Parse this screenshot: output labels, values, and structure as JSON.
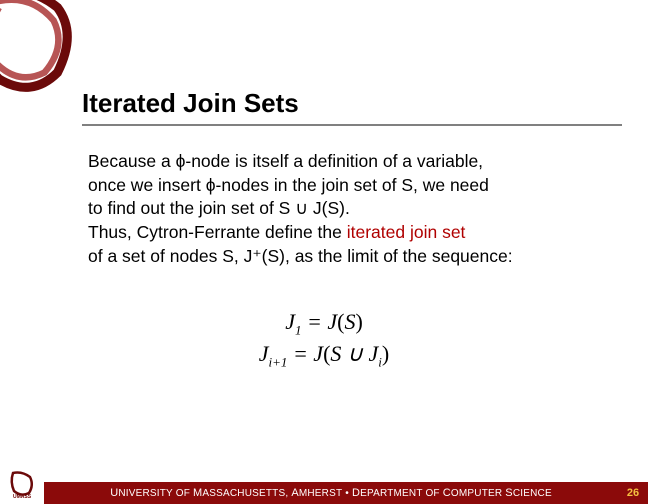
{
  "title": "Iterated Join Sets",
  "body": {
    "l1a": "Because a ",
    "l1b": "-node is itself a definition of a variable,",
    "l2a": "once we insert ",
    "l2b": "-nodes in the join set of S, we need",
    "l3": "to find out the join set of S ∪ J(S).",
    "l4a": "Thus, Cytron-Ferrante define the ",
    "l4b": "iterated join set",
    "l5": "of a set of nodes S, J⁺(S), as the limit of the sequence:"
  },
  "phi": "ϕ",
  "eq": {
    "e1_lhs_j": "J",
    "e1_lhs_sub": "1",
    "e1_eq": " = ",
    "e1_rhs": "J",
    "e1_rhs_arg": "S",
    "e2_lhs_j": "J",
    "e2_lhs_sub": "i+1",
    "e2_eq": " = ",
    "e2_rhs": "J",
    "e2_rhs_arg1": "S ∪ J",
    "e2_rhs_sub": "i"
  },
  "footer": {
    "univ": "UNIVERSITY OF MASSACHUSETTS, AMHERST",
    "sep": " • ",
    "dept": "DEPARTMENT OF COMPUTER SCIENCE",
    "logo": "UMASS"
  },
  "page": "26"
}
